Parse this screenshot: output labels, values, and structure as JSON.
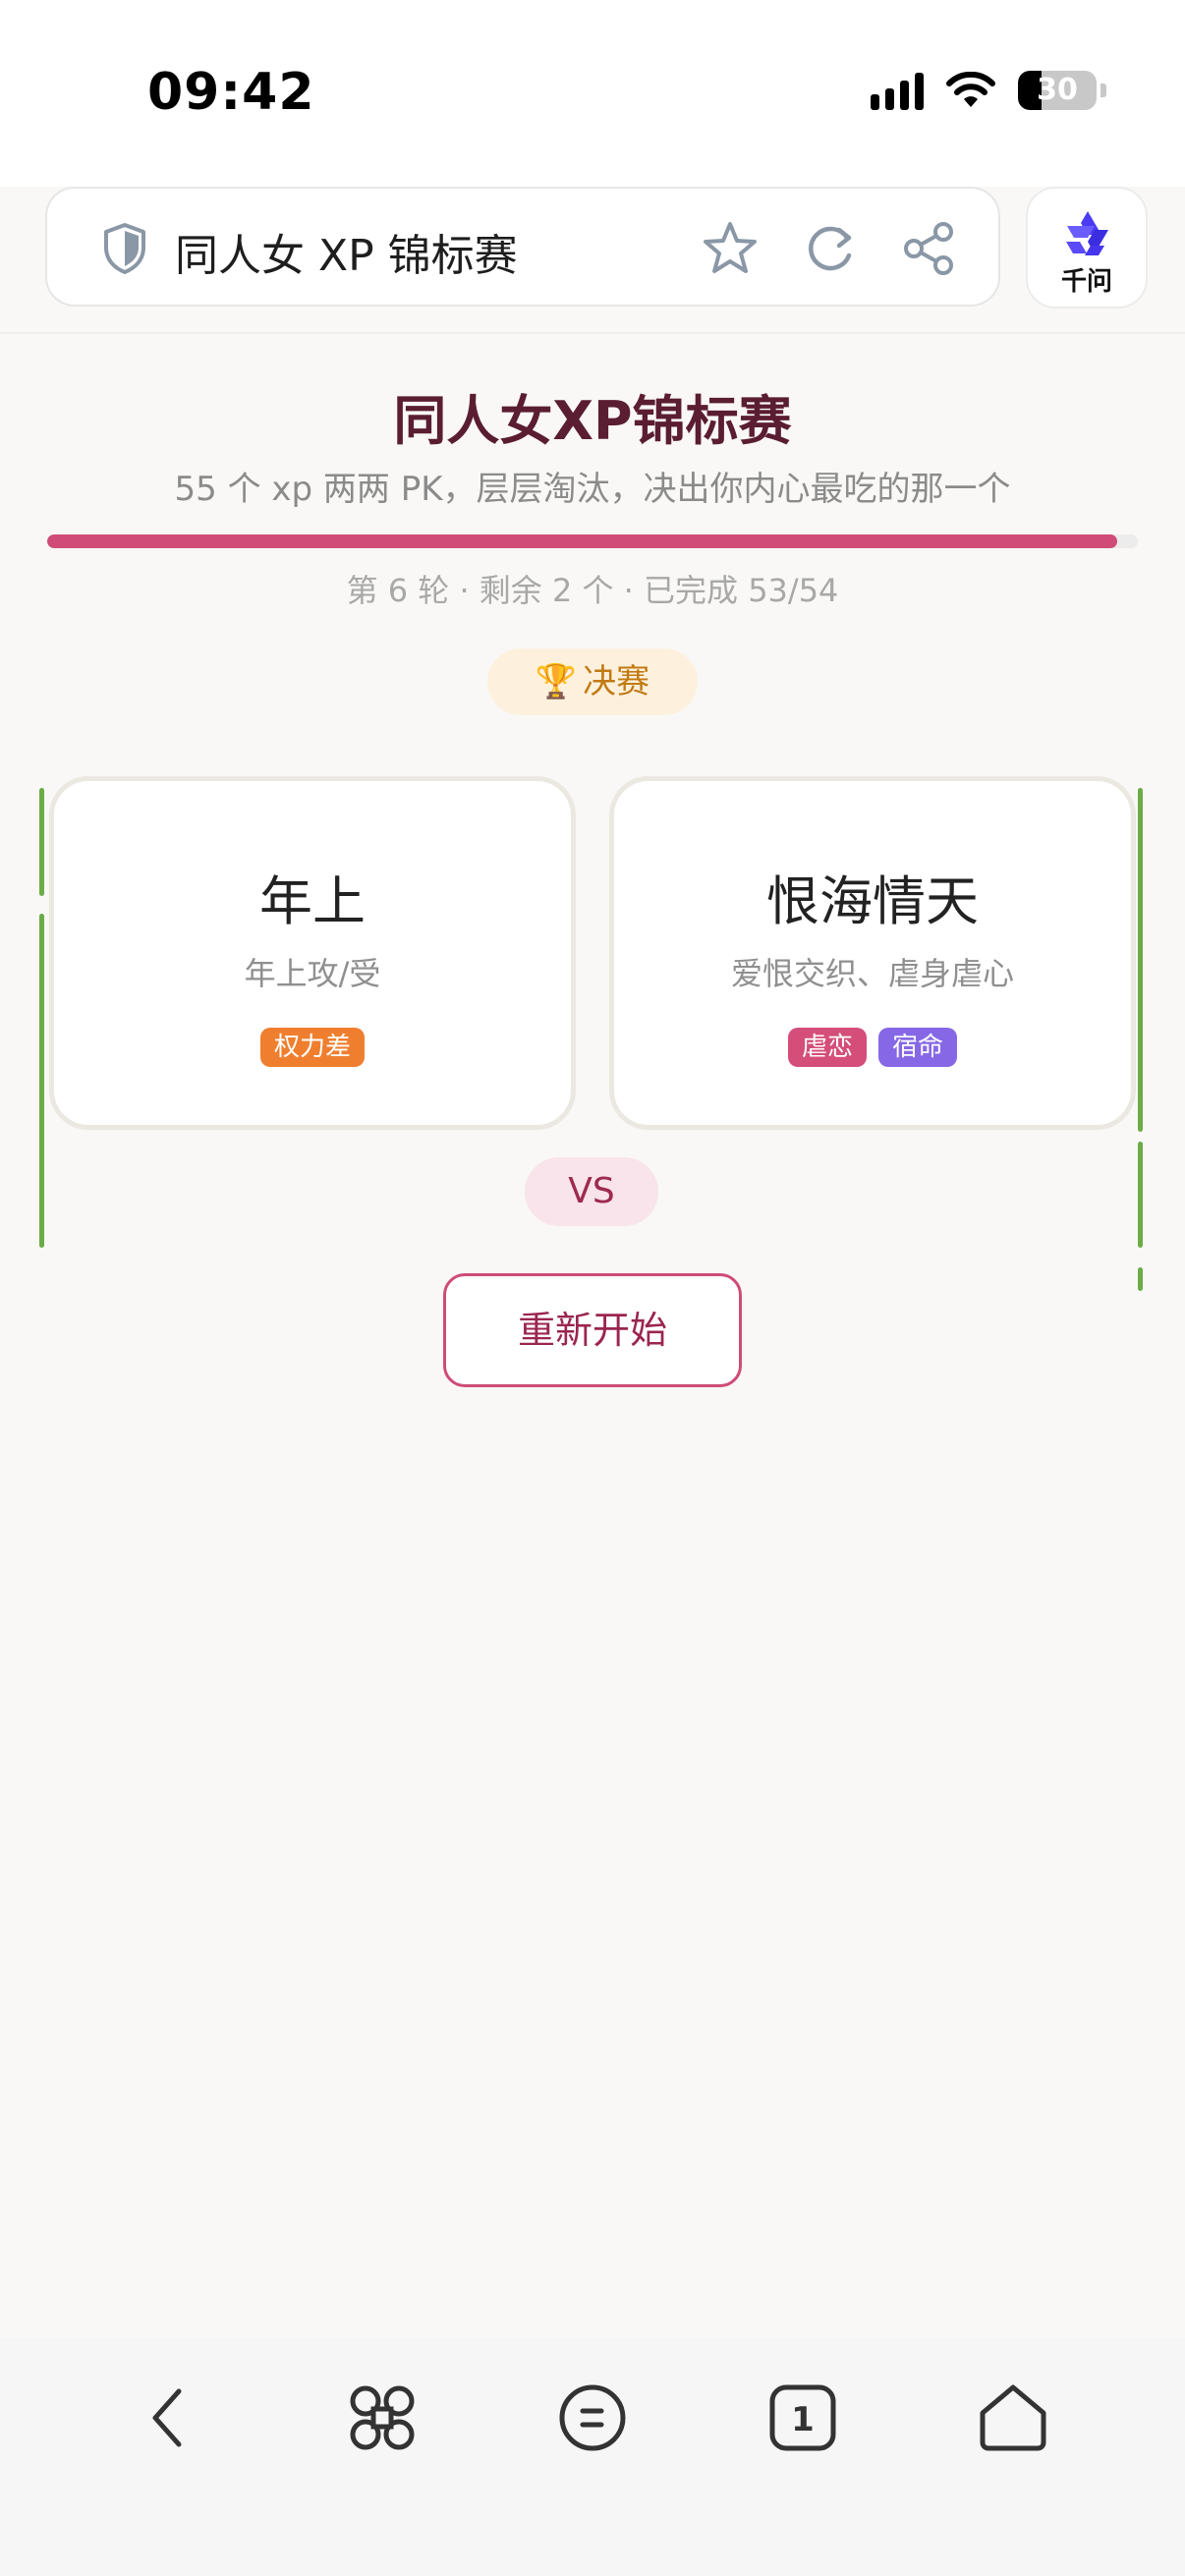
{
  "status_bar": {
    "time": "09:42",
    "battery": "30",
    "battery_level": 0.3
  },
  "browser": {
    "title": "同人女 XP 锦标赛",
    "assistant_label": "千问"
  },
  "header": {
    "title": "同人女XP锦标赛",
    "subtitle": "55 个 xp 两两 PK，层层淘汰，决出你内心最吃的那一个"
  },
  "progress": {
    "completed": 53,
    "total": 54,
    "text": "第 6 轮 · 剩余 2 个 · 已完成 53/54"
  },
  "round": {
    "label": "决赛"
  },
  "cards": [
    {
      "name": "年上",
      "desc": "年上攻/受",
      "tags": [
        {
          "label": "权力差",
          "color": "#ef7f2f"
        }
      ]
    },
    {
      "name": "恨海情天",
      "desc": "爱恨交织、虐身虐心",
      "tags": [
        {
          "label": "虐恋",
          "color": "#d54e7a"
        },
        {
          "label": "宿命",
          "color": "#8668e6"
        }
      ]
    }
  ],
  "vs_label": "VS",
  "restart_label": "重新开始",
  "colors": {
    "accent": "#d04b78",
    "title": "#5a1d32",
    "highlight": "#6aac45"
  }
}
